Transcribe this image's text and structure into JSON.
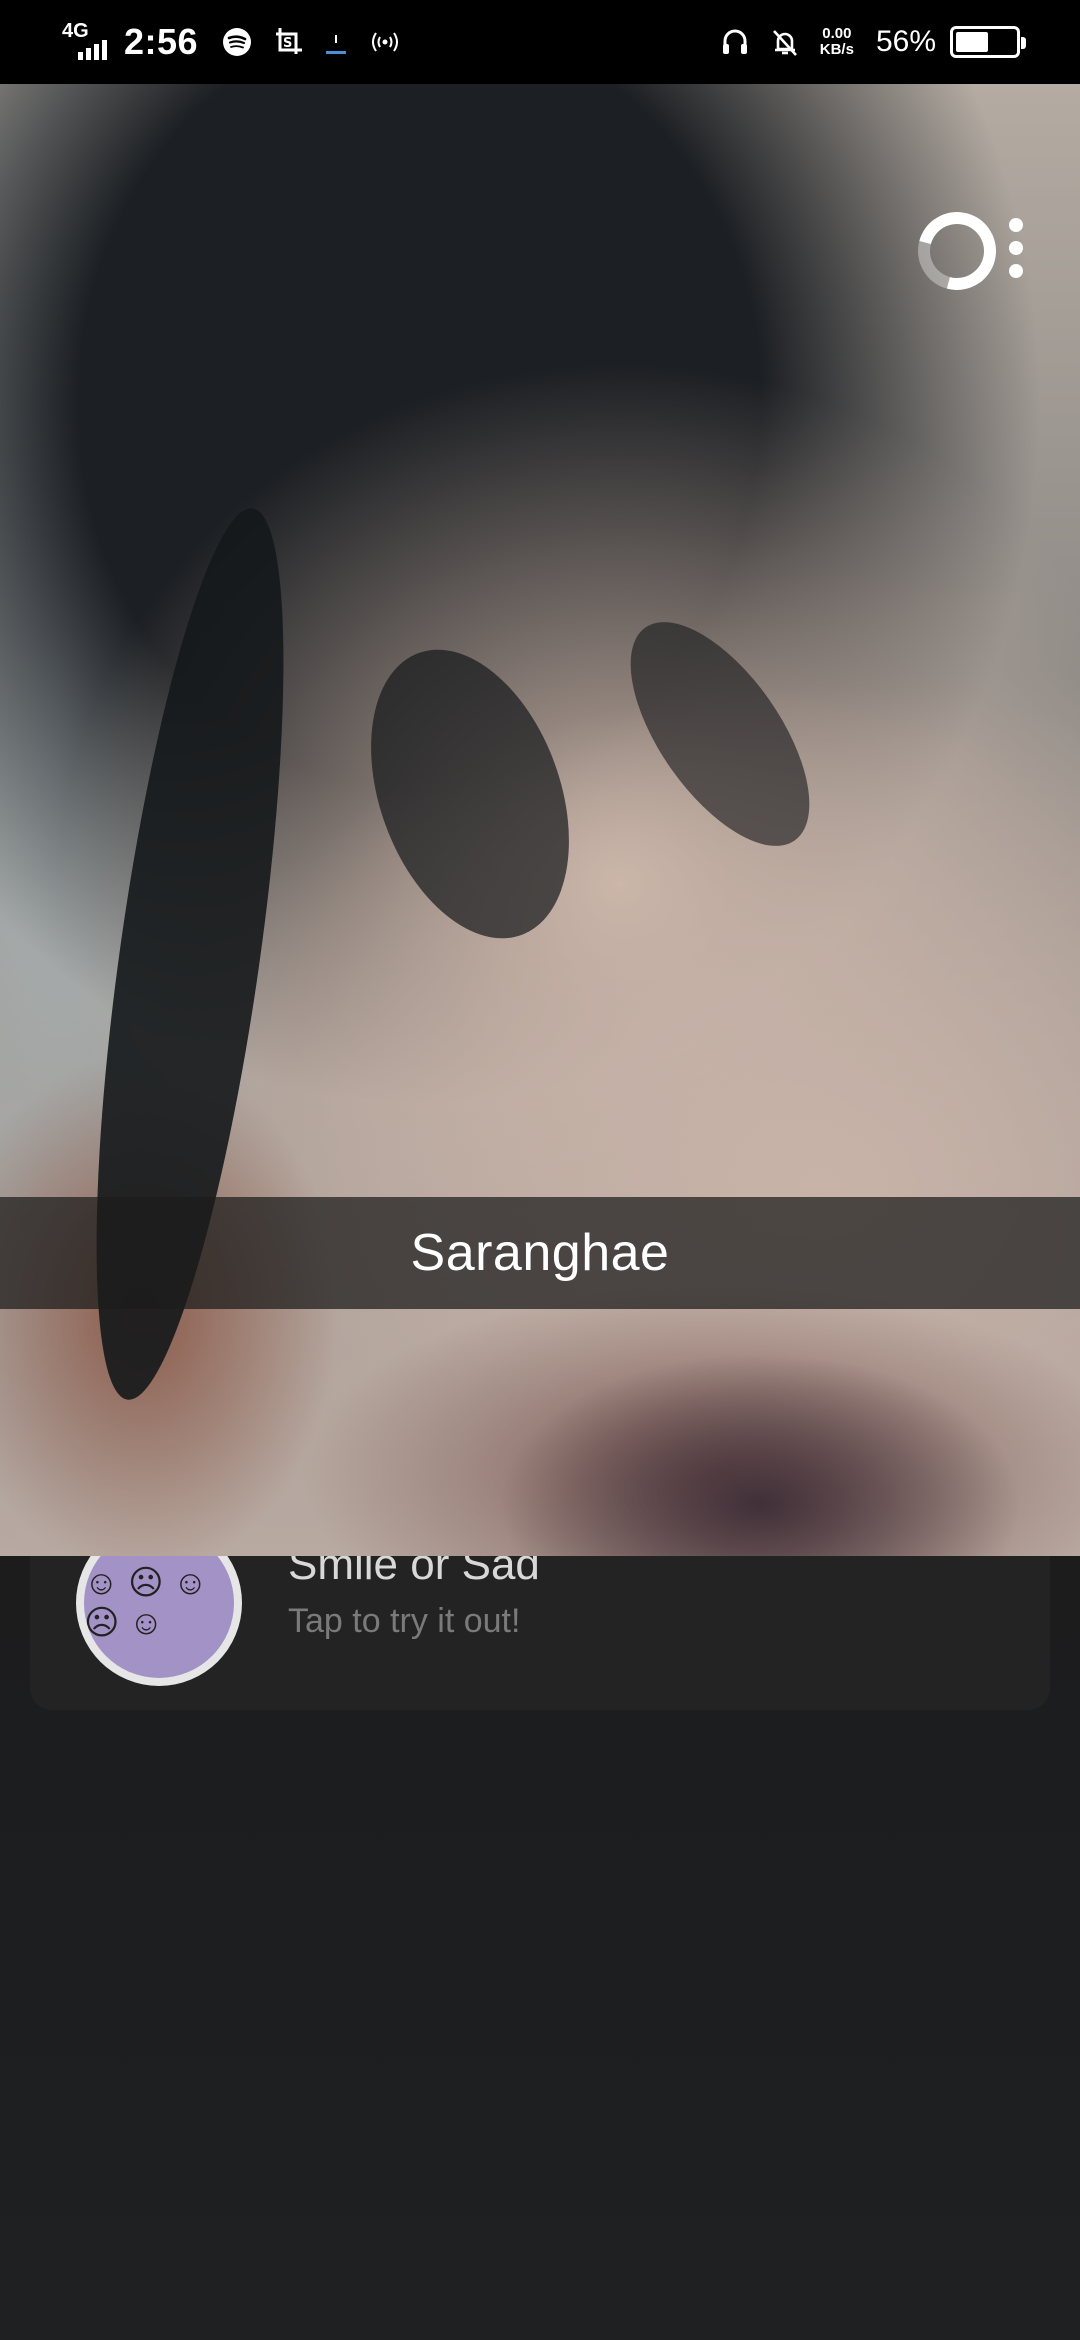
{
  "status_bar": {
    "network": "4G",
    "time": "2:56",
    "speed_value": "0.00",
    "speed_unit": "KB/s",
    "battery_percent": "56%",
    "battery_level": 0.56,
    "icons": [
      "signal-icon",
      "spotify-icon",
      "screenshot-icon",
      "download-icon",
      "hotspot-icon",
      "headphones-icon",
      "mute-bell-icon",
      "battery-icon"
    ]
  },
  "snap": {
    "caption": "Saranghae"
  },
  "lens_card": {
    "title": "Smile or Sad",
    "subtitle": "Tap to try it out!"
  },
  "colors": {
    "caption_bar": "#1c1c1c",
    "lens_thumb": "#a392c6",
    "card_bg": "#232323"
  }
}
